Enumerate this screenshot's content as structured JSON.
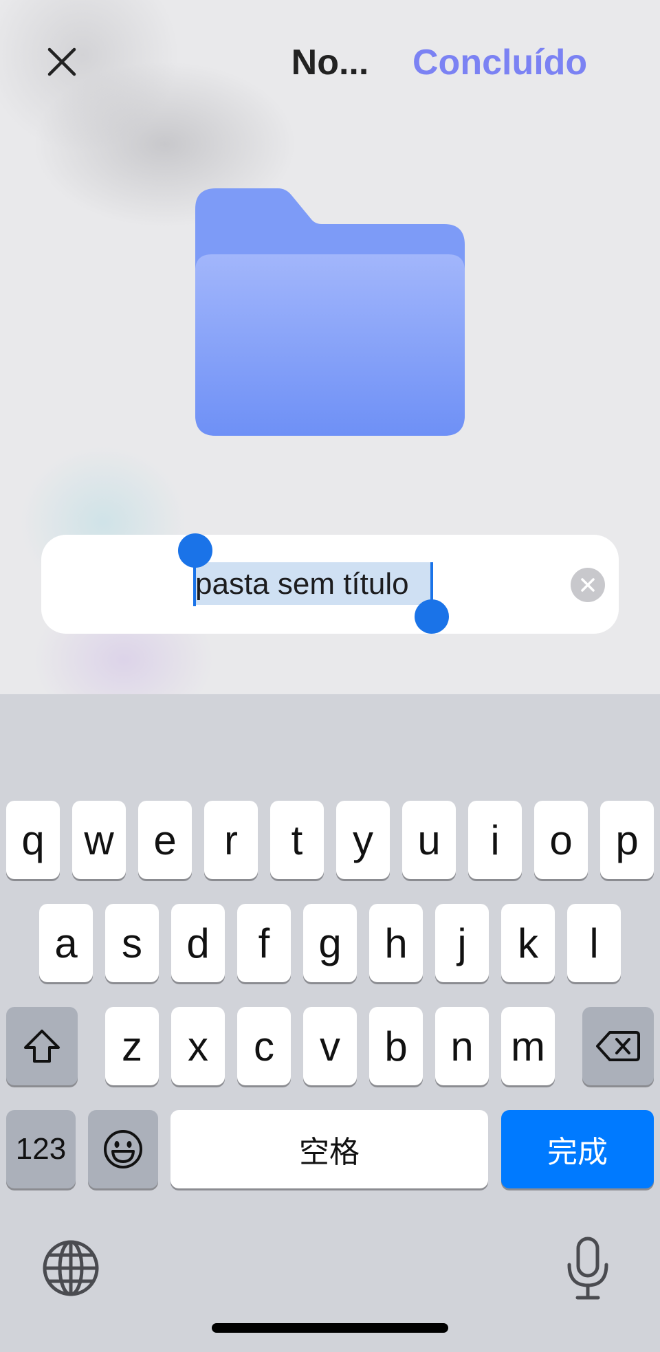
{
  "header": {
    "title": "No...",
    "done_label": "Concluído"
  },
  "name_field": {
    "value": "pasta sem título"
  },
  "keyboard": {
    "row1": [
      "q",
      "w",
      "e",
      "r",
      "t",
      "y",
      "u",
      "i",
      "o",
      "p"
    ],
    "row2": [
      "a",
      "s",
      "d",
      "f",
      "g",
      "h",
      "j",
      "k",
      "l"
    ],
    "row3": [
      "z",
      "x",
      "c",
      "v",
      "b",
      "n",
      "m"
    ],
    "numbers_label": "123",
    "space_label": "空格",
    "return_label": "完成"
  },
  "colors": {
    "accent": "#7b82f3",
    "folder": "#7d9bf7",
    "selection": "#1a73e8",
    "return_key": "#007aff",
    "keyboard_bg": "#d1d3d9"
  },
  "icons": [
    "close-icon",
    "folder-icon",
    "clear-icon",
    "shift-icon",
    "backspace-icon",
    "emoji-icon",
    "globe-icon",
    "microphone-icon"
  ]
}
